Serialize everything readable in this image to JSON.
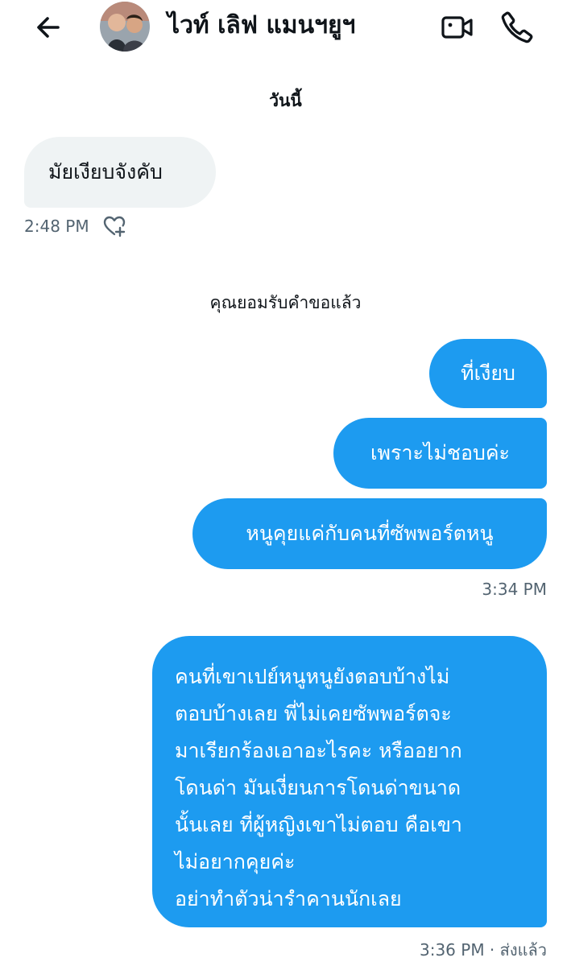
{
  "header": {
    "back_icon": "arrow-left-icon",
    "contact_name": "ไวท์ เลิฟ แมนฯยูฯ",
    "video_icon": "video-camera-icon",
    "call_icon": "phone-icon"
  },
  "conversation": {
    "date_separator": "วันนี้",
    "incoming": {
      "text": "มัยเงียบจังคับ",
      "time": "2:48 PM",
      "like_icon": "heart-plus-icon"
    },
    "system_note": "คุณยอมรับคำขอแล้ว",
    "outgoing_group": {
      "messages": [
        "ที่เงียบ",
        "เพราะไม่ชอบค่ะ",
        "หนูคุยแค่กับคนที่ซัพพอร์ตหนู"
      ],
      "time": "3:34 PM"
    },
    "outgoing_long": {
      "lines": [
        "คนที่เขาเปย์หนูหนูยังตอบบ้างไม่",
        "ตอบบ้างเลย พี่ไม่เคยซัพพอร์ตจะ",
        "มาเรียกร้องเอาอะไรคะ หรืออยาก",
        "โดนด่า มันเงี่ยนการโดนด่าขนาด",
        "นั้นเลย ที่ผู้หญิงเขาไม่ตอบ คือเขา",
        "ไม่อยากคุยค่ะ",
        "อย่าทำตัวน่ารำคานนักเลย"
      ],
      "status": "3:36 PM · ส่งแล้ว"
    }
  },
  "colors": {
    "accent_blue": "#1d9bf0",
    "incoming_bubble": "#eff3f4",
    "meta_text": "#536471",
    "text": "#0f1419"
  }
}
